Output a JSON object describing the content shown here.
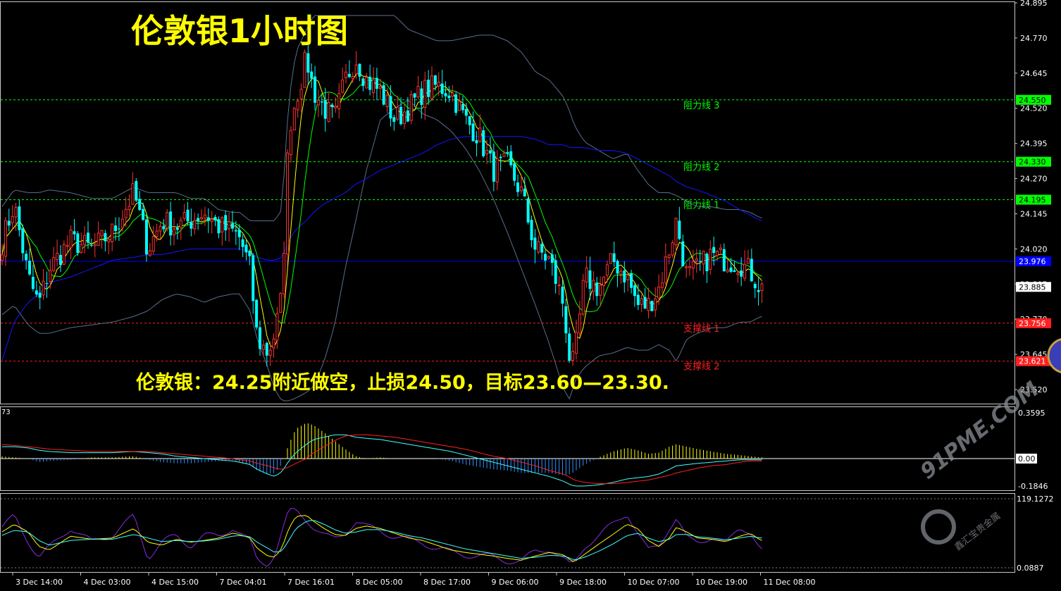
{
  "title": "伦敦银1小时图",
  "note": "伦敦银：24.25附近做空，止损24.50，目标23.60—23.30.",
  "watermark": "91PME.COM",
  "watermark_sub": "鑫汇宝贵金属",
  "colors": {
    "background": "#000000",
    "frame": "#c8c8c8",
    "up_candle": "#ff3030",
    "down_candle": "#00ffff",
    "ma_fast": "#ffff00",
    "ma_mid": "#00ff00",
    "ma_slow": "#1414ff",
    "bollinger": "#5a6e8c",
    "resistance": "#00ff00",
    "support": "#ff2020",
    "current_line": "#0000ff",
    "macd_pos": "#ffff00",
    "macd_neg": "#3090ff",
    "macd_line": "#40ffff",
    "signal_line": "#ff2020",
    "stoch_k": "#8a2be2",
    "stoch_d": "#ffff00",
    "stoch_j": "#40ffff"
  },
  "chart_data": {
    "type": "candlestick",
    "instrument": "伦敦银",
    "timeframe": "1小时",
    "ylim": [
      23.47,
      24.9
    ],
    "y_ticks": [
      "24.895",
      "24.770",
      "24.645",
      "24.520",
      "24.395",
      "24.270",
      "24.145",
      "24.020",
      "23.895",
      "23.770",
      "23.645",
      "23.520"
    ],
    "x_ticks": [
      "3 Dec 14:00",
      "4 Dec 03:00",
      "4 Dec 15:00",
      "7 Dec 04:01",
      "7 Dec 16:01",
      "8 Dec 05:00",
      "8 Dec 17:00",
      "9 Dec 06:00",
      "9 Dec 18:00",
      "10 Dec 07:00",
      "10 Dec 19:00",
      "11 Dec 08:00"
    ],
    "levels": [
      {
        "label": "阻力线 3",
        "value": "24.550",
        "kind": "resistance"
      },
      {
        "label": "阻力线 2",
        "value": "24.330",
        "kind": "resistance"
      },
      {
        "label": "阻力线 1",
        "value": "24.195",
        "kind": "resistance"
      },
      {
        "label": "支撑线 1",
        "value": "23.756",
        "kind": "support"
      },
      {
        "label": "支撑线 2",
        "value": "23.621",
        "kind": "support"
      }
    ],
    "current_price": "23.885",
    "blue_line_price": "23.976",
    "anchors": {
      "x": [
        0,
        20,
        40,
        55,
        70,
        100,
        130,
        160,
        190,
        210,
        230,
        250,
        270,
        290,
        310,
        330,
        340,
        355,
        365,
        380,
        390,
        400,
        410,
        420,
        435,
        445,
        460,
        475,
        490,
        505,
        520,
        540,
        560,
        580,
        600,
        620,
        640,
        660,
        680,
        700,
        720,
        740,
        760,
        780,
        800,
        810,
        815,
        830,
        850,
        870,
        890,
        905,
        920,
        935,
        950,
        960,
        975,
        990,
        1010,
        1030,
        1050,
        1065,
        1080
      ],
      "price": [
        24.02,
        24.18,
        23.92,
        23.82,
        23.95,
        24.05,
        24.02,
        24.08,
        24.22,
        24.02,
        24.12,
        24.1,
        24.12,
        24.15,
        24.1,
        24.08,
        24.06,
        23.95,
        23.7,
        23.65,
        23.72,
        23.85,
        24.45,
        24.55,
        24.7,
        24.58,
        24.52,
        24.48,
        24.62,
        24.7,
        24.62,
        24.58,
        24.48,
        24.52,
        24.58,
        24.6,
        24.58,
        24.48,
        24.42,
        24.3,
        24.32,
        24.22,
        24.02,
        23.98,
        23.82,
        23.6,
        23.62,
        23.92,
        23.88,
        23.98,
        23.92,
        23.82,
        23.82,
        23.88,
        24.02,
        24.12,
        23.92,
        23.95,
        24.0,
        23.98,
        23.97,
        23.94,
        23.88
      ],
      "ma_slow": [
        23.6,
        23.76,
        23.83,
        23.86,
        23.9,
        23.92,
        23.95,
        23.98,
        23.99,
        24.0,
        24.0,
        24.01,
        24.02,
        24.02,
        24.02,
        24.02,
        24.02,
        24.01,
        23.99,
        23.98,
        23.98,
        23.99,
        24.05,
        24.09,
        24.12,
        24.15,
        24.18,
        24.2,
        24.22,
        24.25,
        24.27,
        24.3,
        24.32,
        24.34,
        24.36,
        24.39,
        24.41,
        24.42,
        24.42,
        24.42,
        24.42,
        24.42,
        24.41,
        24.39,
        24.39,
        24.38,
        24.38,
        24.38,
        24.37,
        24.37,
        24.36,
        24.34,
        24.32,
        24.3,
        24.28,
        24.26,
        24.24,
        24.23,
        24.21,
        24.19,
        24.16,
        24.14,
        24.12
      ],
      "bb_upper": [
        24.16,
        24.23,
        24.22,
        24.22,
        24.23,
        24.22,
        24.2,
        24.2,
        24.24,
        24.22,
        24.22,
        24.22,
        24.2,
        24.2,
        24.16,
        24.15,
        24.15,
        24.12,
        24.12,
        24.12,
        24.12,
        24.16,
        24.55,
        24.72,
        24.8,
        24.85,
        24.85,
        24.85,
        24.85,
        24.85,
        24.85,
        24.85,
        24.85,
        24.8,
        24.78,
        24.76,
        24.76,
        24.77,
        24.78,
        24.78,
        24.76,
        24.72,
        24.65,
        24.62,
        24.56,
        24.5,
        24.46,
        24.4,
        24.37,
        24.34,
        24.36,
        24.3,
        24.25,
        24.22,
        24.22,
        24.21,
        24.19,
        24.17,
        24.17,
        24.16,
        24.16,
        24.15,
        24.13
      ],
      "bb_lower": [
        23.78,
        23.82,
        23.75,
        23.72,
        23.72,
        23.74,
        23.75,
        23.76,
        23.78,
        23.8,
        23.84,
        23.86,
        23.85,
        23.83,
        23.85,
        23.86,
        23.86,
        23.8,
        23.7,
        23.6,
        23.52,
        23.48,
        23.48,
        23.49,
        23.51,
        23.53,
        23.62,
        23.75,
        23.95,
        24.12,
        24.3,
        24.48,
        24.52,
        24.55,
        24.5,
        24.48,
        24.44,
        24.38,
        24.3,
        24.2,
        24.08,
        23.95,
        23.82,
        23.68,
        23.52,
        23.48,
        23.55,
        23.6,
        23.64,
        23.65,
        23.67,
        23.66,
        23.66,
        23.68,
        23.66,
        23.62,
        23.7,
        23.72,
        23.74,
        23.74,
        23.76,
        23.76,
        23.78
      ],
      "macd_hist": [
        0.02,
        0.01,
        0.0,
        -0.03,
        -0.02,
        -0.01,
        0.01,
        0.01,
        0.02,
        -0.01,
        -0.03,
        -0.04,
        -0.04,
        -0.03,
        -0.02,
        -0.01,
        -0.03,
        -0.05,
        -0.1,
        -0.13,
        -0.12,
        -0.05,
        0.12,
        0.25,
        0.3,
        0.28,
        0.22,
        0.15,
        0.08,
        0.02,
        0.0,
        0.01,
        0.0,
        0.0,
        0.0,
        0.0,
        -0.02,
        -0.05,
        -0.07,
        -0.09,
        -0.1,
        -0.12,
        -0.12,
        -0.12,
        -0.14,
        -0.13,
        -0.11,
        -0.05,
        0.01,
        0.06,
        0.09,
        0.07,
        0.04,
        0.05,
        0.1,
        0.12,
        0.1,
        0.08,
        0.06,
        0.04,
        0.03,
        0.02,
        0.01
      ],
      "macd_line": [
        0.1,
        0.1,
        0.09,
        0.07,
        0.06,
        0.05,
        0.05,
        0.05,
        0.06,
        0.05,
        0.04,
        0.02,
        0.01,
        0.0,
        -0.01,
        -0.02,
        -0.03,
        -0.05,
        -0.09,
        -0.13,
        -0.15,
        -0.11,
        -0.02,
        0.05,
        0.12,
        0.16,
        0.18,
        0.2,
        0.2,
        0.18,
        0.17,
        0.16,
        0.14,
        0.12,
        0.1,
        0.08,
        0.06,
        0.03,
        0.0,
        -0.03,
        -0.06,
        -0.09,
        -0.12,
        -0.15,
        -0.19,
        -0.22,
        -0.23,
        -0.23,
        -0.22,
        -0.2,
        -0.17,
        -0.16,
        -0.15,
        -0.13,
        -0.09,
        -0.06,
        -0.05,
        -0.04,
        -0.03,
        -0.02,
        -0.01,
        -0.01,
        -0.01
      ],
      "signal_line": [
        0.12,
        0.11,
        0.1,
        0.09,
        0.08,
        0.07,
        0.06,
        0.06,
        0.06,
        0.06,
        0.05,
        0.04,
        0.03,
        0.02,
        0.01,
        0.0,
        -0.01,
        -0.02,
        -0.04,
        -0.06,
        -0.08,
        -0.09,
        -0.07,
        -0.04,
        0.0,
        0.05,
        0.1,
        0.15,
        0.19,
        0.2,
        0.2,
        0.19,
        0.18,
        0.16,
        0.14,
        0.12,
        0.1,
        0.08,
        0.05,
        0.02,
        0.0,
        -0.03,
        -0.06,
        -0.1,
        -0.13,
        -0.16,
        -0.18,
        -0.2,
        -0.21,
        -0.21,
        -0.2,
        -0.19,
        -0.18,
        -0.16,
        -0.14,
        -0.12,
        -0.1,
        -0.08,
        -0.06,
        -0.05,
        -0.03,
        -0.02,
        -0.02
      ],
      "stoch_k": [
        65,
        88,
        48,
        20,
        35,
        70,
        45,
        58,
        88,
        20,
        45,
        55,
        40,
        55,
        55,
        70,
        60,
        45,
        15,
        10,
        25,
        60,
        95,
        98,
        85,
        70,
        55,
        50,
        62,
        80,
        70,
        65,
        55,
        48,
        45,
        35,
        28,
        25,
        22,
        20,
        15,
        12,
        30,
        35,
        15,
        5,
        10,
        40,
        55,
        75,
        95,
        60,
        30,
        40,
        70,
        85,
        50,
        45,
        55,
        40,
        70,
        65,
        30
      ],
      "stoch_d": [
        60,
        75,
        62,
        38,
        32,
        55,
        50,
        52,
        68,
        45,
        40,
        50,
        45,
        48,
        52,
        60,
        58,
        52,
        35,
        22,
        20,
        35,
        68,
        88,
        90,
        80,
        68,
        58,
        56,
        68,
        72,
        68,
        60,
        52,
        48,
        40,
        32,
        28,
        25,
        22,
        18,
        15,
        22,
        28,
        24,
        15,
        12,
        25,
        42,
        58,
        75,
        68,
        48,
        38,
        52,
        70,
        62,
        52,
        50,
        46,
        55,
        60,
        48
      ],
      "stoch_j": [
        55,
        65,
        62,
        48,
        40,
        48,
        50,
        50,
        58,
        52,
        46,
        48,
        46,
        47,
        50,
        55,
        56,
        54,
        45,
        35,
        28,
        30,
        48,
        68,
        80,
        82,
        75,
        66,
        60,
        62,
        66,
        66,
        62,
        56,
        52,
        46,
        40,
        34,
        30,
        26,
        22,
        18,
        20,
        23,
        22,
        18,
        15,
        20,
        30,
        42,
        56,
        60,
        52,
        46,
        50,
        58,
        58,
        54,
        52,
        49,
        52,
        55,
        52
      ]
    },
    "macd_panel": {
      "label": "73",
      "ticks": [
        "0.3595",
        "0.00",
        "-0.1846"
      ],
      "ylim": [
        -0.23,
        0.39
      ]
    },
    "stoch_panel": {
      "ticks": [
        "119.1272",
        "0.0887"
      ],
      "ylim": [
        0,
        120
      ]
    }
  }
}
